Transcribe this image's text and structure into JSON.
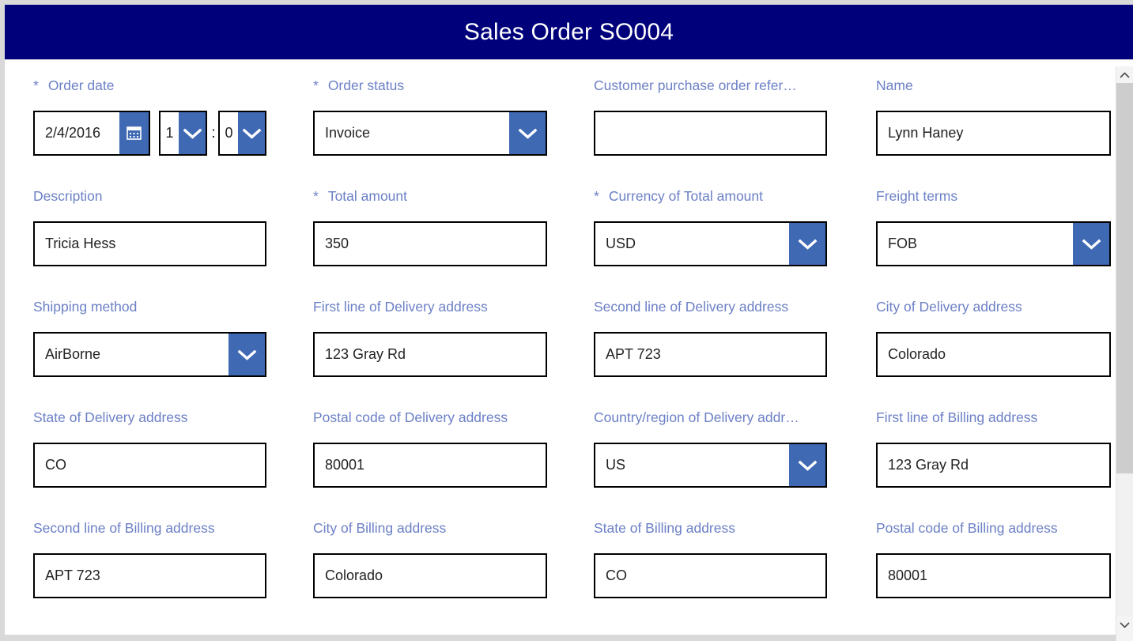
{
  "window": {
    "title": "Sales Order SO004",
    "accent_color": "#00007b",
    "label_color": "#6c80c6",
    "control_button_color": "#4069b4"
  },
  "form": {
    "required_marker": "*",
    "rows": [
      {
        "fields": [
          {
            "name": "order-date",
            "label": "Order date",
            "required": true,
            "type": "datetime",
            "date_value": "2/4/2016",
            "hour_value": "1",
            "time_separator": ":",
            "minute_value": "0",
            "calendar_icon": "calendar-icon",
            "dropdown_icon": "chevron-down-icon"
          },
          {
            "name": "order-status",
            "label": "Order status",
            "required": true,
            "type": "dropdown",
            "value": "Invoice",
            "dropdown_icon": "chevron-down-icon"
          },
          {
            "name": "customer-purchase-order-reference",
            "label": "Customer purchase order refer…",
            "required": false,
            "type": "text",
            "value": ""
          },
          {
            "name": "name",
            "label": "Name",
            "required": false,
            "type": "text",
            "value": "Lynn Haney"
          }
        ]
      },
      {
        "fields": [
          {
            "name": "description",
            "label": "Description",
            "required": false,
            "type": "text",
            "value": "Tricia Hess"
          },
          {
            "name": "total-amount",
            "label": "Total amount",
            "required": true,
            "type": "text",
            "value": "350"
          },
          {
            "name": "currency-of-total-amount",
            "label": "Currency of Total amount",
            "required": true,
            "type": "dropdown",
            "value": "USD",
            "dropdown_icon": "chevron-down-icon"
          },
          {
            "name": "freight-terms",
            "label": "Freight terms",
            "required": false,
            "type": "dropdown",
            "value": "FOB",
            "dropdown_icon": "chevron-down-icon"
          }
        ]
      },
      {
        "fields": [
          {
            "name": "shipping-method",
            "label": "Shipping method",
            "required": false,
            "type": "dropdown",
            "value": "AirBorne",
            "dropdown_icon": "chevron-down-icon"
          },
          {
            "name": "first-line-of-delivery-address",
            "label": "First line of Delivery address",
            "required": false,
            "type": "text",
            "value": "123 Gray Rd"
          },
          {
            "name": "second-line-of-delivery-address",
            "label": "Second line of Delivery address",
            "required": false,
            "type": "text",
            "value": "APT 723"
          },
          {
            "name": "city-of-delivery-address",
            "label": "City of Delivery address",
            "required": false,
            "type": "text",
            "value": "Colorado"
          }
        ]
      },
      {
        "fields": [
          {
            "name": "state-of-delivery-address",
            "label": "State of Delivery address",
            "required": false,
            "type": "text",
            "value": "CO"
          },
          {
            "name": "postal-code-of-delivery-address",
            "label": "Postal code of Delivery address",
            "required": false,
            "type": "text",
            "value": "80001"
          },
          {
            "name": "country-region-of-delivery-address",
            "label": "Country/region of Delivery addr…",
            "required": false,
            "type": "dropdown",
            "value": "US",
            "dropdown_icon": "chevron-down-icon"
          },
          {
            "name": "first-line-of-billing-address",
            "label": "First line of Billing address",
            "required": false,
            "type": "text",
            "value": "123 Gray Rd"
          }
        ]
      },
      {
        "fields": [
          {
            "name": "second-line-of-billing-address",
            "label": "Second line of Billing address",
            "required": false,
            "type": "text",
            "value": "APT 723"
          },
          {
            "name": "city-of-billing-address",
            "label": "City of Billing address",
            "required": false,
            "type": "text",
            "value": "Colorado"
          },
          {
            "name": "state-of-billing-address",
            "label": "State of Billing address",
            "required": false,
            "type": "text",
            "value": "CO"
          },
          {
            "name": "postal-code-of-billing-address",
            "label": "Postal code of Billing address",
            "required": false,
            "type": "text",
            "value": "80001"
          }
        ]
      }
    ]
  },
  "scrollbar": {
    "up_icon": "chevron-up-icon",
    "down_icon": "chevron-down-icon"
  }
}
